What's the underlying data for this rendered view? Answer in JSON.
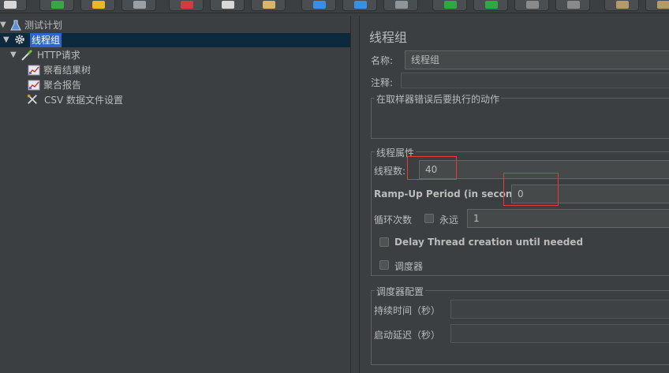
{
  "toolbar": {
    "buttons": [
      "new-icon",
      "templates-icon",
      "open-icon",
      "save-icon",
      "cut-icon",
      "copy-icon",
      "paste-icon",
      "expand-icon",
      "collapse-icon",
      "toggle-icon",
      "start-icon",
      "start-no-pause-icon",
      "stop-icon",
      "shutdown-icon",
      "clear-icon",
      "clear-all-icon"
    ]
  },
  "tree": {
    "items": [
      {
        "label": "测试计划",
        "icon": "flask-icon"
      },
      {
        "label": "线程组",
        "icon": "gear-icon"
      },
      {
        "label": "HTTP请求",
        "icon": "pipette-icon"
      },
      {
        "label": "察看结果树",
        "icon": "chart-icon"
      },
      {
        "label": "聚合报告",
        "icon": "chart-icon"
      },
      {
        "label": "CSV 数据文件设置",
        "icon": "tools-icon"
      }
    ]
  },
  "panel": {
    "title": "线程组",
    "name_label": "名称:",
    "name_value": "线程组",
    "comment_label": "注释:",
    "error_action_title": "在取样器错误后要执行的动作",
    "thread_props_title": "线程属性",
    "threads_label": "线程数:",
    "threads_value": "40",
    "rampup_label": "Ramp-Up Period (in seconds):",
    "rampup_value": "0",
    "loop_label": "循环次数",
    "forever_label": "永远",
    "loop_value": "1",
    "delay_label": "Delay Thread creation until needed",
    "scheduler_label": "调度器",
    "scheduler_config_title": "调度器配置",
    "duration_label": "持续时间（秒）",
    "startup_delay_label": "启动延迟（秒）"
  },
  "colors": {
    "background": "#3c3f41",
    "selection": "#2f65ca",
    "highlight_box": "#e23b3b"
  }
}
